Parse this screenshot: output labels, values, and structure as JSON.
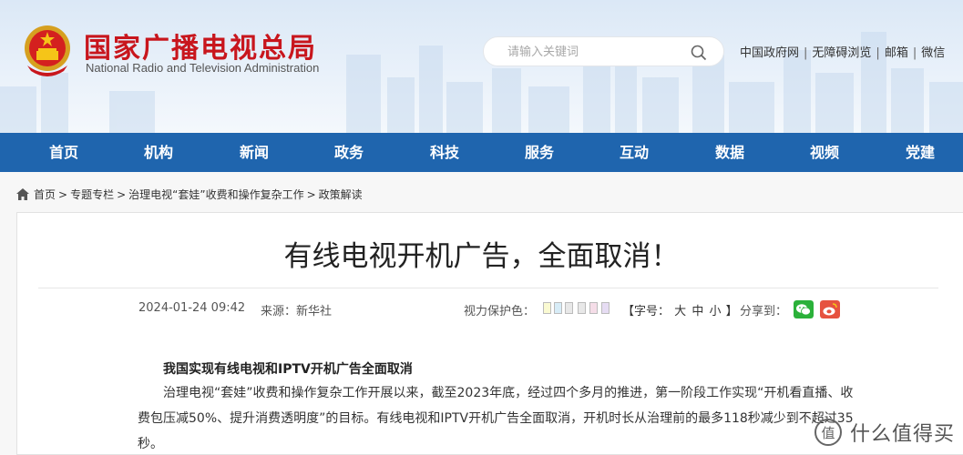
{
  "site": {
    "title": "国家广播电视总局",
    "subtitle": "National Radio and Television Administration"
  },
  "search": {
    "placeholder": "请输入关键词"
  },
  "toplinks": [
    "中国政府网",
    "无障碍浏览",
    "邮箱",
    "微信"
  ],
  "nav": [
    "首页",
    "机构",
    "新闻",
    "政务",
    "科技",
    "服务",
    "互动",
    "数据",
    "视频",
    "党建"
  ],
  "breadcrumb": [
    "首页",
    "专题专栏",
    "治理电视“套娃”收费和操作复杂工作",
    "政策解读"
  ],
  "article": {
    "title": "有线电视开机广告，全面取消！",
    "datetime": "2024-01-24 09:42",
    "source": "来源：新华社",
    "eye_label": "视力保护色：",
    "font_open": "【字号：",
    "font_sizes": [
      "大",
      "中",
      "小"
    ],
    "font_close": "】",
    "share_label": "分享到：",
    "lead": "我国实现有线电视和IPTV开机广告全面取消",
    "paragraph": "治理电视“套娃”收费和操作复杂工作开展以来，截至2023年底，经过四个多月的推进，第一阶段工作实现“开机看直播、收费包压减50%、提升消费透明度”的目标。有线电视和IPTV开机广告全面取消，开机时长从治理前的最多118秒减少到不超过35秒。"
  },
  "eye_colors": [
    "#fafad2",
    "#d7ecf7",
    "#e8e8e8",
    "#e8e8e8",
    "#f5dde8",
    "#e6dcf3"
  ],
  "colors": {
    "brand_red": "#c8161d",
    "nav_blue": "#1f65ae",
    "wechat_green": "#2bb13a",
    "weibo_red": "#e6523f"
  },
  "watermark": {
    "text": "什么值得买"
  }
}
